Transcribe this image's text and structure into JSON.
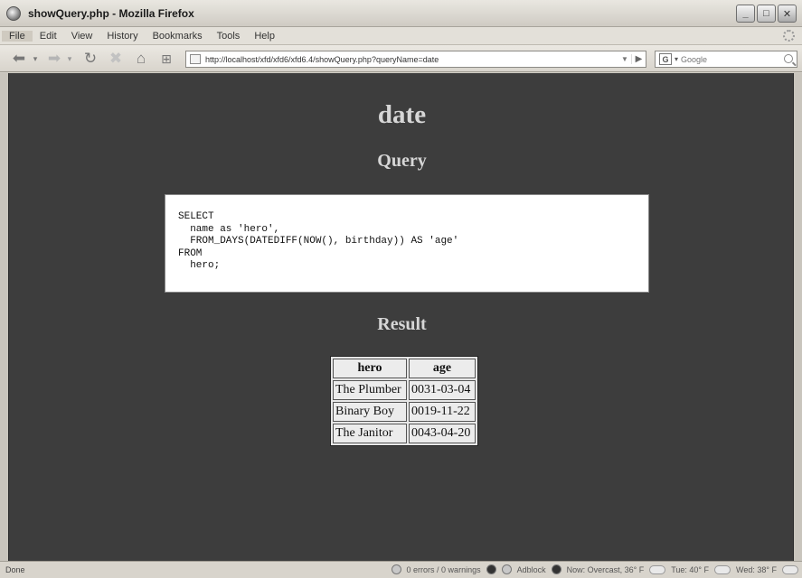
{
  "window": {
    "title": "showQuery.php - Mozilla Firefox",
    "controls": {
      "minimize": "_",
      "maximize": "□",
      "close": "✕"
    }
  },
  "menu": [
    "File",
    "Edit",
    "View",
    "History",
    "Bookmarks",
    "Tools",
    "Help"
  ],
  "toolbar": {
    "url": "http://localhost/xfd/xfd6/xfd6.4/showQuery.php?queryName=date",
    "search_engine_label": "G",
    "search_placeholder": "Google",
    "icons": [
      "back-icon",
      "forward-icon",
      "reload-icon",
      "stop-icon",
      "home-icon",
      "new-tab-icon"
    ]
  },
  "page": {
    "heading": "date",
    "query_heading": "Query",
    "query_sql": "SELECT\n  name as 'hero',\n  FROM_DAYS(DATEDIFF(NOW(), birthday)) AS 'age'\nFROM\n  hero;",
    "result_heading": "Result",
    "table": {
      "headers": [
        "hero",
        "age"
      ],
      "rows": [
        [
          "The Plumber",
          "0031-03-04"
        ],
        [
          "Binary Boy",
          "0019-11-22"
        ],
        [
          "The Janitor",
          "0043-04-20"
        ]
      ]
    }
  },
  "status": {
    "left": "Done",
    "errors": "0 errors / 0 warnings",
    "adblock": "Adblock",
    "weather_now": "Now: Overcast, 36° F",
    "weather_tue": "Tue: 40° F",
    "weather_wed": "Wed: 38° F"
  }
}
